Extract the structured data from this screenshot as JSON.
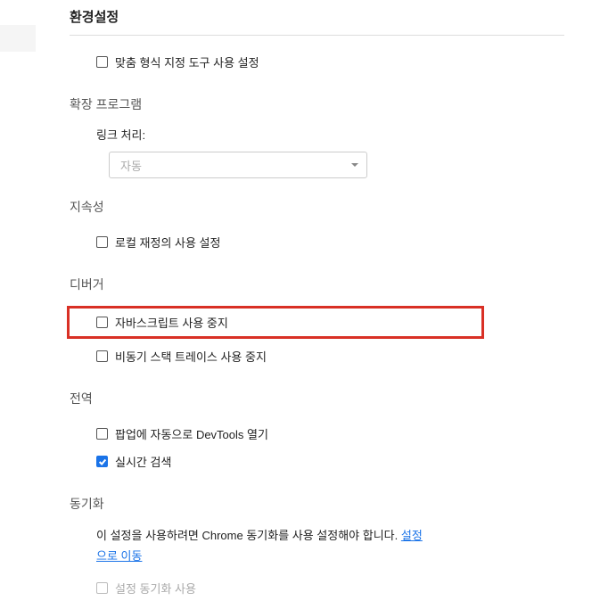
{
  "page_title": "환경설정",
  "preferences": {
    "format_tool": {
      "label": "맞춤 형식 지정 도구 사용 설정",
      "checked": false
    }
  },
  "extensions": {
    "title": "확장 프로그램",
    "link_handling_label": "링크 처리:",
    "link_handling_value": "자동"
  },
  "persistence": {
    "title": "지속성",
    "local_overrides": {
      "label": "로컬 재정의 사용 설정",
      "checked": false
    }
  },
  "debugger": {
    "title": "디버거",
    "disable_js": {
      "label": "자바스크립트 사용 중지",
      "checked": false
    },
    "disable_async_stack": {
      "label": "비동기 스택 트레이스 사용 중지",
      "checked": false
    }
  },
  "global": {
    "title": "전역",
    "auto_open_devtools": {
      "label": "팝업에 자동으로 DevTools 열기",
      "checked": false
    },
    "realtime_search": {
      "label": "실시간 검색",
      "checked": true
    }
  },
  "sync": {
    "title": "동기화",
    "description_part1": "이 설정을 사용하려면 Chrome 동기화를 사용 설정해야 합니다. ",
    "link_text": "설정으로 이동",
    "sync_settings": {
      "label": "설정 동기화 사용",
      "checked": false,
      "disabled": true
    }
  }
}
